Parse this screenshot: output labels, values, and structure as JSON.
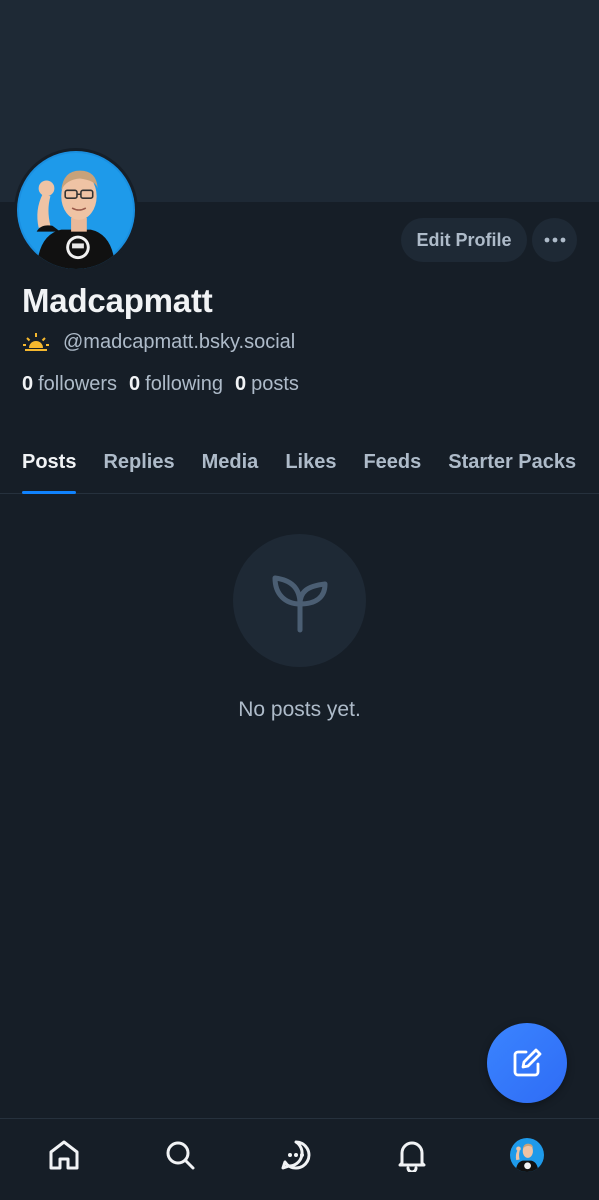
{
  "profile": {
    "display_name": "Madcapmatt",
    "handle": "@madcapmatt.bsky.social",
    "handle_emoji": "sunrise-icon",
    "stats": {
      "followers_count": "0",
      "followers_label": "followers",
      "following_count": "0",
      "following_label": "following",
      "posts_count": "0",
      "posts_label": "posts"
    }
  },
  "actions": {
    "edit_profile_label": "Edit Profile",
    "more_icon": "ellipsis-icon"
  },
  "tabs": [
    {
      "label": "Posts",
      "active": true
    },
    {
      "label": "Replies",
      "active": false
    },
    {
      "label": "Media",
      "active": false
    },
    {
      "label": "Likes",
      "active": false
    },
    {
      "label": "Feeds",
      "active": false
    },
    {
      "label": "Starter Packs",
      "active": false
    }
  ],
  "empty_state": {
    "icon": "sprout-icon",
    "text": "No posts yet."
  },
  "fab": {
    "icon": "compose-icon"
  },
  "bottom_nav": [
    {
      "icon": "home-icon"
    },
    {
      "icon": "search-icon"
    },
    {
      "icon": "chat-icon"
    },
    {
      "icon": "bell-icon"
    },
    {
      "icon": "profile-avatar"
    }
  ],
  "colors": {
    "background": "#161e27",
    "banner": "#1e2935",
    "accent": "#1083fe",
    "muted_text": "#aebbc9",
    "fab": "#3a84ff"
  }
}
